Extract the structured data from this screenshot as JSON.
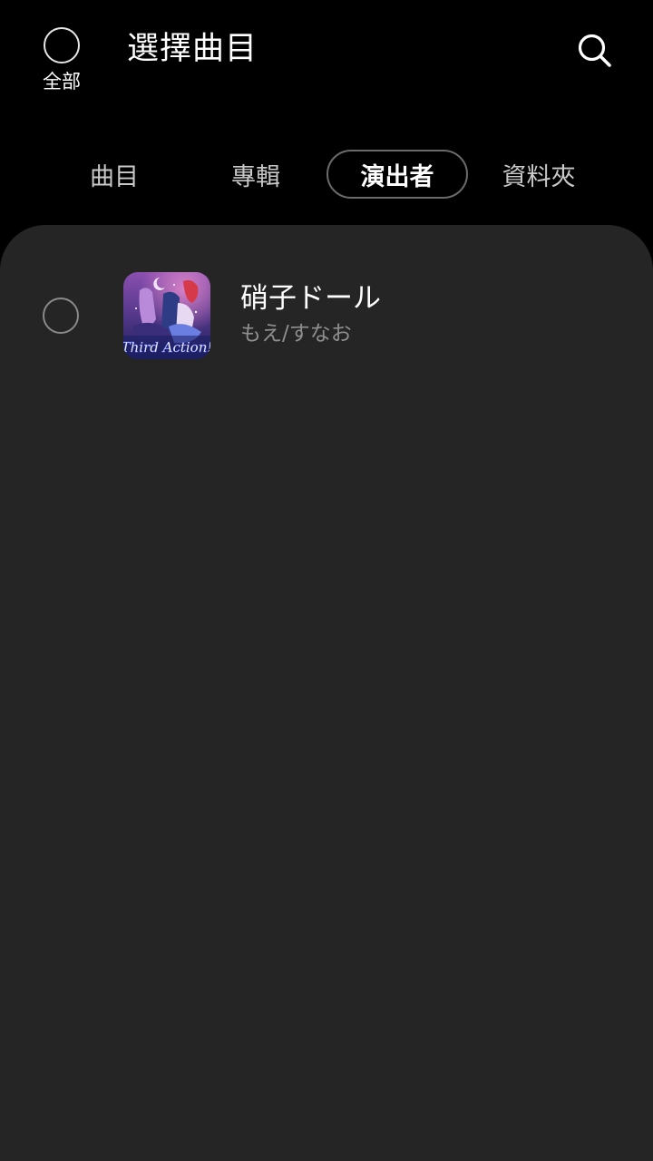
{
  "header": {
    "select_all_label": "全部",
    "title": "選擇曲目",
    "search_icon": "search-icon"
  },
  "tabs": [
    {
      "label": "曲目",
      "active": false
    },
    {
      "label": "專輯",
      "active": false
    },
    {
      "label": "演出者",
      "active": true
    },
    {
      "label": "資料夾",
      "active": false
    }
  ],
  "list": {
    "items": [
      {
        "title": "硝子ドール",
        "subtitle": "もえ/すなお",
        "art_text": "Third Action!",
        "checked": false
      }
    ]
  },
  "colors": {
    "background": "#000000",
    "panel": "#252525",
    "text_primary": "#ffffff",
    "text_secondary": "#8f8f8f",
    "tab_inactive": "#c9c9c9",
    "tab_active_border": "#6a6a6a"
  }
}
